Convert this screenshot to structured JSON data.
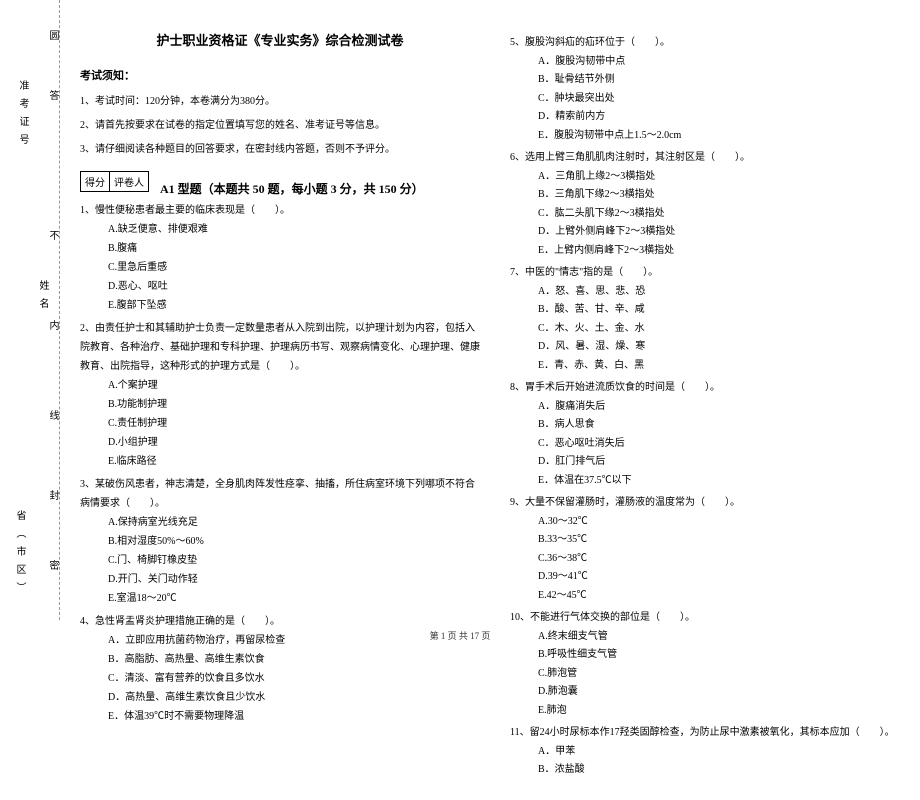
{
  "binding": {
    "zhunkao": "准考证号",
    "province": "省（市区）",
    "name": "姓名",
    "marks": [
      "圆",
      "答",
      "不",
      "内",
      "线",
      "封",
      "密"
    ]
  },
  "header": {
    "title": "护士职业资格证《专业实务》综合检测试卷",
    "notice_heading": "考试须知：",
    "instructions": [
      "1、考试时间：120分钟，本卷满分为380分。",
      "2、请首先按要求在试卷的指定位置填写您的姓名、准考证号等信息。",
      "3、请仔细阅读各种题目的回答要求，在密封线内答题，否则不予评分。"
    ],
    "score_label": "得分",
    "grader_label": "评卷人",
    "section_a1": "A1 型题（本题共 50 题，每小题 3 分，共 150 分）"
  },
  "questions_col1": [
    {
      "text": "1、慢性便秘患者最主要的临床表现是（　　）。",
      "options": [
        "A.缺乏便意、排便艰难",
        "B.腹痛",
        "C.里急后重感",
        "D.恶心、呕吐",
        "E.腹部下坠感"
      ]
    },
    {
      "text": "2、由责任护士和其辅助护士负责一定数量患者从入院到出院，以护理计划为内容，包括入院教育、各种治疗、基础护理和专科护理、护理病历书写、观察病情变化、心理护理、健康教育、出院指导，这种形式的护理方式是（　　）。",
      "options": [
        "A.个案护理",
        "B.功能制护理",
        "C.责任制护理",
        "D.小组护理",
        "E.临床路径"
      ]
    },
    {
      "text": "3、某破伤风患者，神志清楚，全身肌肉阵发性痉挛、抽搐，所住病室环境下列哪项不符合病情要求（　　）。",
      "options": [
        "A.保持病室光线充足",
        "B.相对湿度50%～60%",
        "C.门、椅脚钉橡皮垫",
        "D.开门、关门动作轻",
        "E.室温18～20℃"
      ]
    },
    {
      "text": "4、急性肾盂肾炎护理措施正确的是（　　）。",
      "options": [
        "A．立即应用抗菌药物治疗，再留尿检查",
        "B．高脂肪、高热量、高维生素饮食",
        "C．清淡、富有营养的饮食且多饮水",
        "D．高热量、高维生素饮食且少饮水",
        "E．体温39℃时不需要物理降温"
      ]
    }
  ],
  "questions_col2": [
    {
      "text": "5、腹股沟斜疝的疝环位于（　　）。",
      "options": [
        "A．腹股沟韧带中点",
        "B．耻骨结节外侧",
        "C．肿块最突出处",
        "D．精索前内方",
        "E．腹股沟韧带中点上1.5～2.0cm"
      ]
    },
    {
      "text": "6、选用上臂三角肌肌肉注射时，其注射区是（　　）。",
      "options": [
        "A．三角肌上缘2～3横指处",
        "B．三角肌下缘2～3横指处",
        "C．肱二头肌下缘2～3横指处",
        "D．上臂外侧肩峰下2～3横指处",
        "E．上臂内侧肩峰下2～3横指处"
      ]
    },
    {
      "text": "7、中医的\"情志\"指的是（　　）。",
      "options": [
        "A．怒、喜、思、悲、恐",
        "B．酸、苦、甘、辛、咸",
        "C．木、火、土、金、水",
        "D．风、暑、湿、燥、寒",
        "E．青、赤、黄、白、黑"
      ]
    },
    {
      "text": "8、胃手术后开始进流质饮食的时间是（　　）。",
      "options": [
        "A．腹痛消失后",
        "B．病人思食",
        "C．恶心呕吐消失后",
        "D．肛门排气后",
        "E．体温在37.5℃以下"
      ]
    },
    {
      "text": "9、大量不保留灌肠时，灌肠液的温度常为（　　）。",
      "options": [
        "A.30～32℃",
        "B.33～35℃",
        "C.36～38℃",
        "D.39～41℃",
        "E.42～45℃"
      ]
    },
    {
      "text": "10、不能进行气体交换的部位是（　　）。",
      "options": [
        "A.终末细支气管",
        "B.呼吸性细支气管",
        "C.肺泡管",
        "D.肺泡囊",
        "E.肺泡"
      ]
    },
    {
      "text": "11、留24小时尿标本作17羟类固醇检查，为防止尿中激素被氧化，其标本应加（　　）。",
      "options": [
        "A．甲苯",
        "B．浓盐酸"
      ]
    }
  ],
  "footer": {
    "text": "第 1 页 共 17 页"
  }
}
